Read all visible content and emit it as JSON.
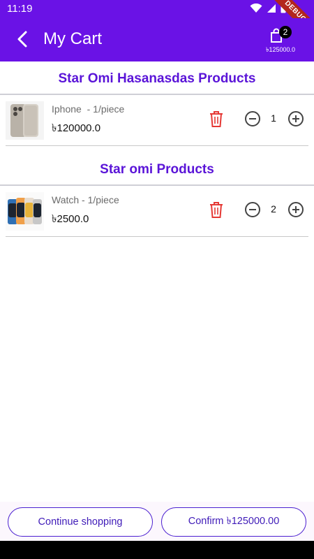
{
  "status_bar": {
    "time": "11:19",
    "debug_label": "DEBUG"
  },
  "app_bar": {
    "title": "My Cart",
    "cart_badge_count": "2",
    "cart_total": "৳125000.0"
  },
  "sections": [
    {
      "title": "Star Omi Hasanasdas Products",
      "items": [
        {
          "name": "Iphone  - 1/piece",
          "price": "৳120000.0",
          "quantity": "1",
          "image": "iphone"
        }
      ]
    },
    {
      "title": "Star omi Products",
      "items": [
        {
          "name": "Watch - 1/piece",
          "price": "৳2500.0",
          "quantity": "2",
          "image": "watch"
        }
      ]
    }
  ],
  "bottom": {
    "continue_label": "Continue shopping",
    "confirm_label": "Confirm ৳125000.00"
  },
  "colors": {
    "primary": "#6a12e6",
    "accent_text": "#5a14d8",
    "delete": "#e53935"
  }
}
